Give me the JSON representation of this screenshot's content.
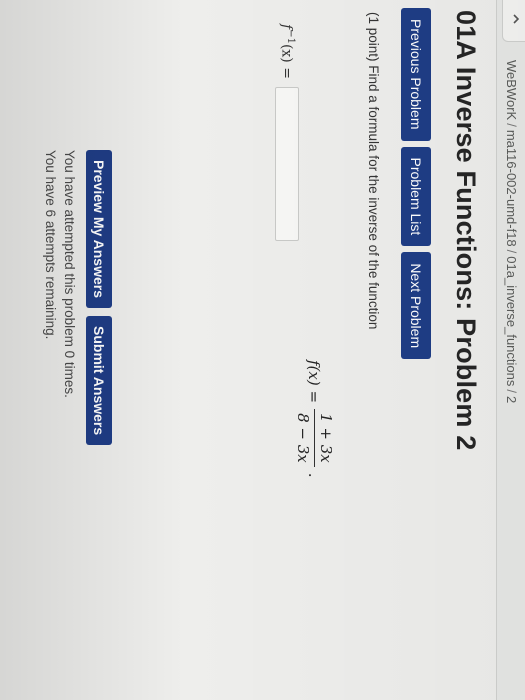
{
  "breadcrumb": {
    "items": [
      "WeBWorK",
      "ma116-002-umd-f18",
      "01a_inverse_functions",
      "2"
    ],
    "separator": "/"
  },
  "page_title": "01A Inverse Functions: Problem 2",
  "nav": {
    "previous": "Previous Problem",
    "list": "Problem List",
    "next": "Next Problem"
  },
  "problem": {
    "statement": "(1 point) Find a formula for the inverse of the function",
    "formula_lhs": "f(x) =",
    "numerator": "1 + 3x",
    "denominator": "8 − 3x",
    "formula_end": ".",
    "answer_label_f": "f",
    "answer_label_sup": "−1",
    "answer_label_rest": "(x) =",
    "answer_value": ""
  },
  "actions": {
    "preview": "Preview My Answers",
    "submit": "Submit Answers"
  },
  "status": {
    "attempted": "You have attempted this problem 0 times.",
    "remaining": "You have 6 attempts remaining."
  },
  "colors": {
    "button_bg": "#1f3d86",
    "button_text": "#ffffff",
    "page_bg": "#eeeeec"
  },
  "icons": {
    "home": "home-icon"
  }
}
